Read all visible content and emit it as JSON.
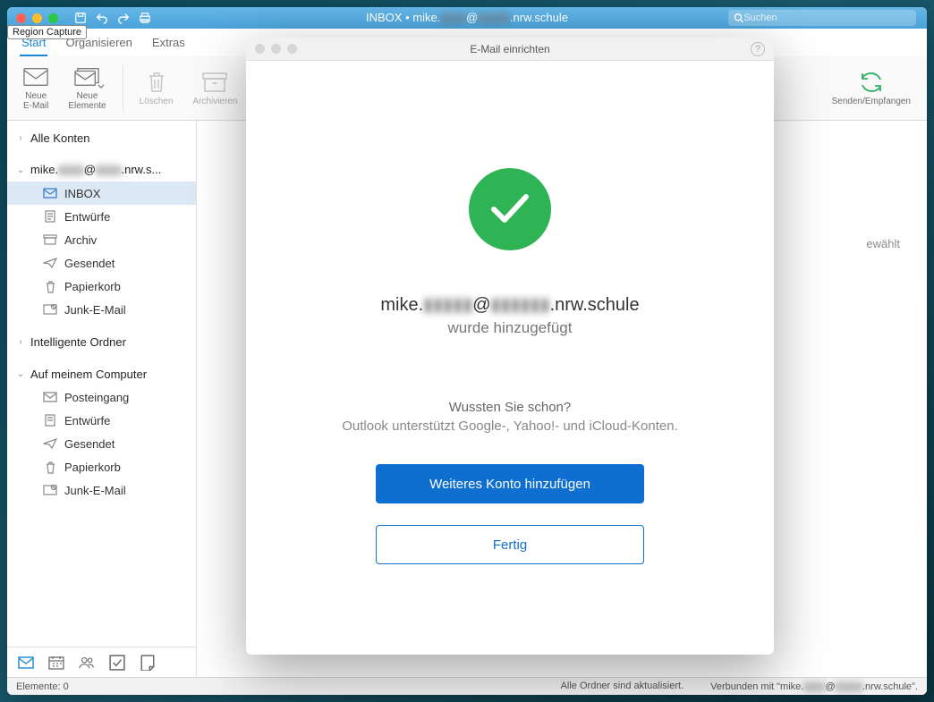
{
  "capture_badge": "Region Capture",
  "titlebar": {
    "title_prefix": "INBOX • mike.",
    "title_blur": "▮▮▮▮",
    "title_mid": "@",
    "title_blur2": "▮▮▮▮▮",
    "title_suffix": ".nrw.schule",
    "search_placeholder": "Suchen"
  },
  "ribbon": {
    "tabs": {
      "start": "Start",
      "organisieren": "Organisieren",
      "extras": "Extras"
    },
    "new_email": "Neue\nE-Mail",
    "new_elements": "Neue\nElemente",
    "delete": "Löschen",
    "archive": "Archivieren",
    "sendrecv": "Senden/Empfangen"
  },
  "sidebar": {
    "all_accounts": "Alle Konten",
    "account1_prefix": "mike.",
    "account1_blur": "▮▮▮▮",
    "account1_mid": "@",
    "account1_blur2": "▮▮▮▮",
    "account1_suffix": ".nrw.s...",
    "folders1": {
      "inbox": "INBOX",
      "drafts": "Entwürfe",
      "archive": "Archiv",
      "sent": "Gesendet",
      "trash": "Papierkorb",
      "junk": "Junk-E-Mail"
    },
    "smart": "Intelligente Ordner",
    "local": "Auf meinem Computer",
    "folders2": {
      "inbox": "Posteingang",
      "drafts": "Entwürfe",
      "sent": "Gesendet",
      "trash": "Papierkorb",
      "junk": "Junk-E-Mail"
    }
  },
  "main": {
    "placeholder_suffix": "ewählt"
  },
  "statusbar": {
    "items": "Elemente: 0",
    "sync": "Alle Ordner sind aktualisiert.",
    "conn_prefix": "Verbunden mit \"mike.",
    "conn_blur": "▮▮▮▮",
    "conn_mid": "@",
    "conn_blur2": "▮▮▮▮▮",
    "conn_suffix": ".nrw.schule\"."
  },
  "dialog": {
    "title": "E-Mail einrichten",
    "email_prefix": "mike.",
    "email_blur": "▮▮▮▮▮",
    "email_mid": "@",
    "email_blur2": "▮▮▮▮▮▮",
    "email_suffix": ".nrw.schule",
    "added": "wurde hinzugefügt",
    "dyk_head": "Wussten Sie schon?",
    "dyk_body": "Outlook unterstützt Google-, Yahoo!- und iCloud-Konten.",
    "btn_add": "Weiteres Konto hinzufügen",
    "btn_done": "Fertig"
  }
}
